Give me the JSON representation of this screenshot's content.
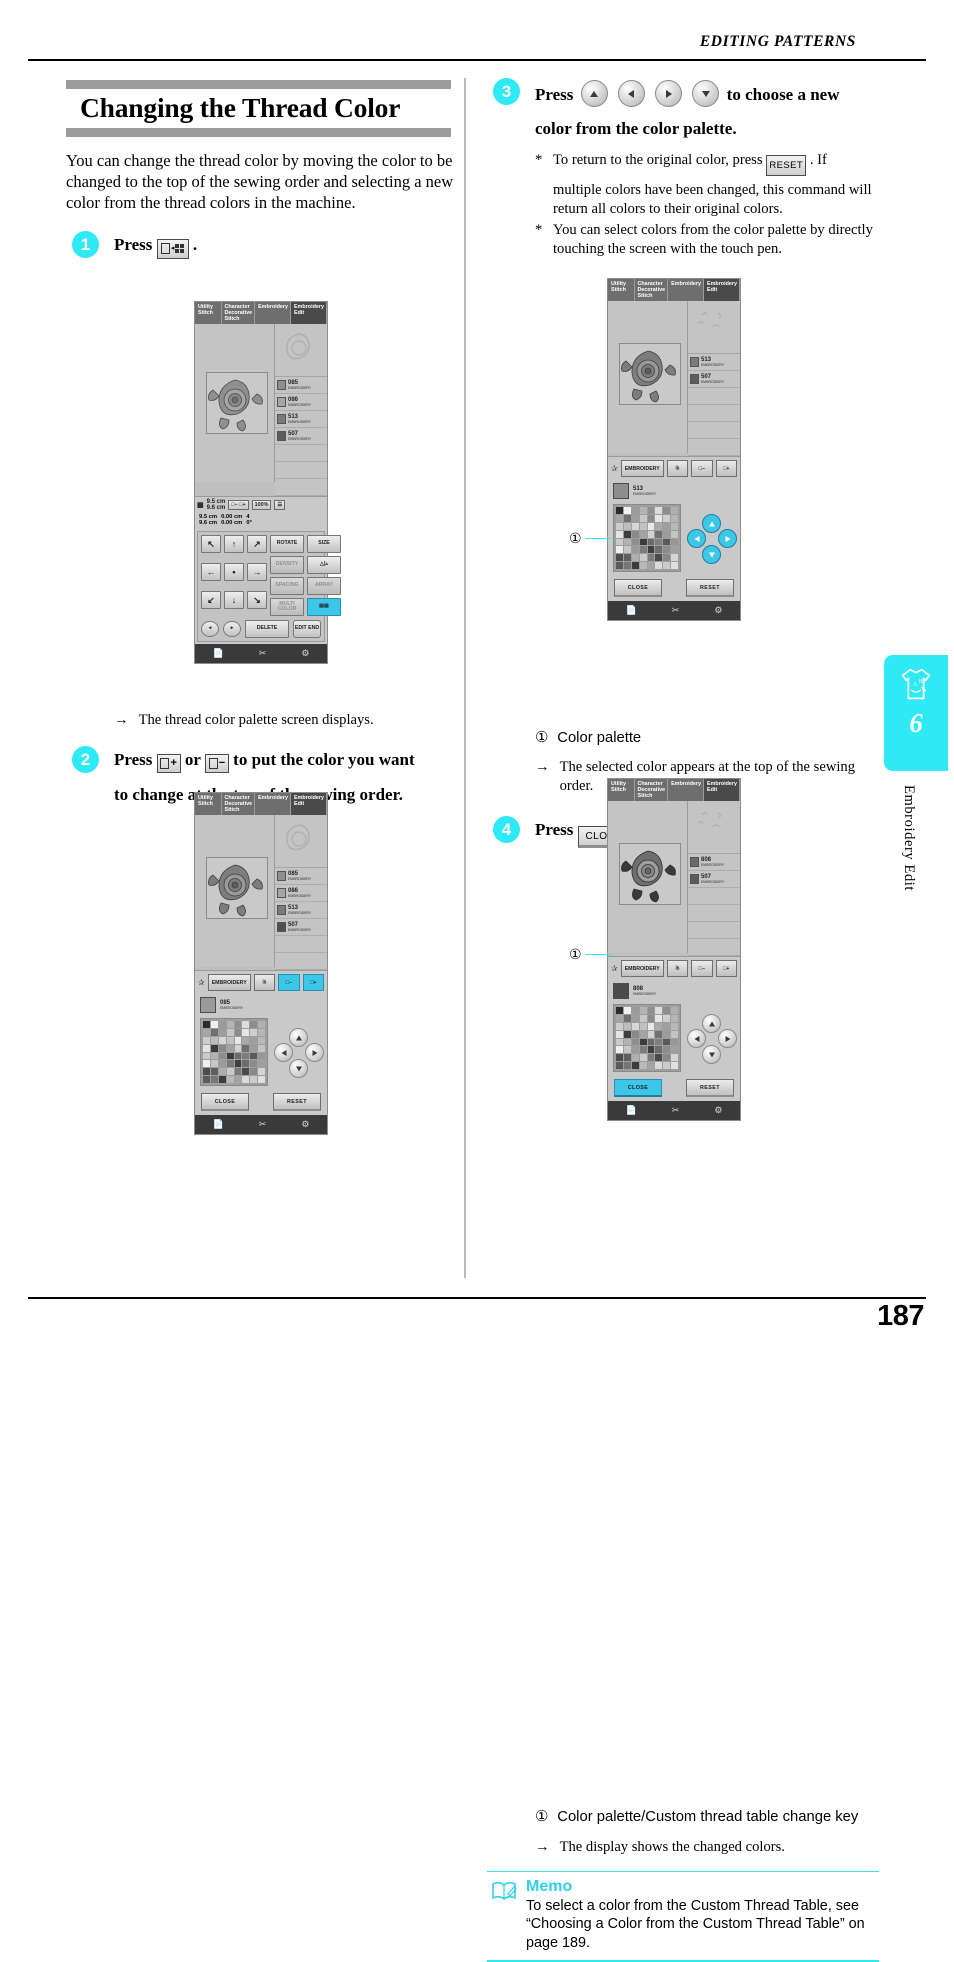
{
  "header": {
    "running_head": "EDITING PATTERNS",
    "page_number": "187"
  },
  "side_tab": {
    "chapter_number": "6",
    "chapter_label": "Embroidery Edit",
    "icon": "tshirt-icon"
  },
  "section": {
    "title": "Changing the Thread Color",
    "intro": "You can change the thread color by moving the color to be changed to the top of the sewing order and selecting a new color from the thread colors in the machine."
  },
  "steps": {
    "one": {
      "number": "1",
      "press_label": "Press",
      "key_label": "color-shuffle-key",
      "period": ".",
      "result": "The thread color palette screen displays.",
      "arrow": "→",
      "caption": ""
    },
    "two": {
      "number": "2",
      "press_label": "Press",
      "key_plus": "+",
      "key_minus": "−",
      "or_label": "or",
      "line1_tail": "to put the color you want",
      "line2": "to change at the top of the sewing order."
    },
    "three": {
      "number": "3",
      "press_label": "Press",
      "line1_tail": "to choose a new",
      "line2": "color from the color palette.",
      "notes": [
        {
          "star": "*",
          "pre": "To return to the original color, press",
          "key": "RESET",
          "post": ". If",
          "rest": "multiple colors have been changed, this command will return all colors to their original colors."
        },
        {
          "star": "*",
          "pre": "",
          "key": "",
          "post": "",
          "rest": "You can select colors from the color palette by directly touching the screen with the touch pen."
        }
      ],
      "callout": {
        "num": "①",
        "text": "Color palette"
      },
      "arrow": "→",
      "result": "The selected color appears at the top of the sewing order."
    },
    "four": {
      "number": "4",
      "press_label": "Press",
      "key_close": "CLOSE",
      "period": ".",
      "callout": {
        "num": "①",
        "text": "Color palette/Custom thread table change key"
      },
      "arrow": "→",
      "result": "The display shows the changed colors."
    }
  },
  "memo": {
    "title": "Memo",
    "icon": "memo-book-icon",
    "text": "To select a color from the Custom Thread Table, see “Choosing a Color from the Custom Thread Table” on page 189."
  },
  "machine_screens": {
    "tabs": [
      {
        "label": "Utility Stitch",
        "active": false
      },
      {
        "label": "Character Decorative Stitch",
        "active": false
      },
      {
        "label": "Embroidery",
        "active": false
      },
      {
        "label": "Embroidery Edit",
        "active": true
      }
    ],
    "screen1": {
      "colors": [
        {
          "num": "085",
          "name": "EMBROIDERY",
          "swatch": "#8e8e8e"
        },
        {
          "num": "086",
          "name": "EMBROIDERY",
          "swatch": "#a5a5a5"
        },
        {
          "num": "513",
          "name": "EMBROIDERY",
          "swatch": "#7a7a7a"
        },
        {
          "num": "507",
          "name": "EMBROIDERY",
          "swatch": "#5c5c5c"
        }
      ],
      "measure": {
        "size_w": "9.5 cm",
        "size_h": "9.6 cm",
        "zoom": "100%",
        "offset_v": "0.00 cm",
        "offset_h": "0.00 cm",
        "count": "4",
        "angle": "0°"
      },
      "pad": {
        "rotate": "ROTATE",
        "size": "SIZE",
        "density": "DENSITY",
        "mirror": "mirror-icon",
        "spacing": "SPACING",
        "array": "ARRAY",
        "multi_color": "MULTI COLOR",
        "color_shuffle": "color-shuffle-icon",
        "delete": "DELETE",
        "edit_end": "EDIT END"
      }
    },
    "screen2": {
      "colors": [
        {
          "num": "085",
          "name": "EMBROIDERY",
          "swatch": "#8e8e8e"
        },
        {
          "num": "086",
          "name": "EMBROIDERY",
          "swatch": "#a5a5a5"
        },
        {
          "num": "513",
          "name": "EMBROIDERY",
          "swatch": "#7a7a7a"
        },
        {
          "num": "507",
          "name": "EMBROIDERY",
          "swatch": "#4f4f4f"
        }
      ],
      "toolbar": {
        "mode": "EMBROIDERY",
        "minus": "−",
        "plus": "+",
        "highlight": "plus-minus"
      },
      "selected": {
        "num": "085",
        "name": "EMBROIDERY",
        "swatch": "#9a9a9a"
      },
      "close": "CLOSE",
      "reset": "RESET"
    },
    "screen3": {
      "colors": [
        {
          "num": "513",
          "name": "EMBROIDERY",
          "swatch": "#7a7a7a"
        },
        {
          "num": "507",
          "name": "EMBROIDERY",
          "swatch": "#5c5c5c"
        }
      ],
      "toolbar": {
        "mode": "EMBROIDERY",
        "minus": "−",
        "plus": "+",
        "highlight": "none"
      },
      "selected": {
        "num": "513",
        "name": "EMBROIDERY",
        "swatch": "#8d8d8d"
      },
      "close": "CLOSE",
      "reset": "RESET",
      "dpad_highlight": "all",
      "callout_num": "①"
    },
    "screen4": {
      "colors": [
        {
          "num": "808",
          "name": "EMBROIDERY",
          "swatch": "#6a6a6a"
        },
        {
          "num": "507",
          "name": "EMBROIDERY",
          "swatch": "#5c5c5c"
        }
      ],
      "toolbar": {
        "mode": "EMBROIDERY",
        "minus": "−",
        "plus": "+",
        "highlight": "none"
      },
      "selected": {
        "num": "808",
        "name": "EMBROIDERY",
        "swatch": "#4a4a4a"
      },
      "close": "CLOSE",
      "reset": "RESET",
      "close_highlight": true,
      "callout_num": "①"
    },
    "palette_rows": [
      [
        "#2b2b2b",
        "#f0f0f0",
        "#9a9a9a",
        "#b4b4b4",
        "#8f8f8f",
        "#dcdcdc",
        "#8d8d8d",
        "#b0b0b0"
      ],
      [
        "#a6a6a6",
        "#6f6f6f",
        "#9d9d9d",
        "#c8c8c8",
        "#8b8b8b",
        "#e6e6e6",
        "#cfcfcf",
        "#b6b6b6"
      ],
      [
        "#cdcdcd",
        "#bdbdbd",
        "#d6d6d6",
        "#c2c2c2",
        "#e9e9e9",
        "#a9a9a9",
        "#9f9f9f",
        "#b8b8b8"
      ],
      [
        "#e4e4e4",
        "#3d3d3d",
        "#8a8a8a",
        "#a3a3a3",
        "#d2d2d2",
        "#707070",
        "#9c9c9c",
        "#c4c4c4"
      ],
      [
        "#cacaca",
        "#b2b2b2",
        "#8e8e8e",
        "#3b3b3b",
        "#6b6b6b",
        "#7e7e7e",
        "#5a5a5a",
        "#979797"
      ],
      [
        "#efefef",
        "#c6c6c6",
        "#9b9b9b",
        "#7c7c7c",
        "#3f3f3f",
        "#6d6d6d",
        "#8c8c8c",
        "#a0a0a0"
      ],
      [
        "#4c4c4c",
        "#5f5f5f",
        "#aeaeae",
        "#c9c9c9",
        "#7b7b7b",
        "#4a4a4a",
        "#888888",
        "#d5d5d5"
      ],
      [
        "#5b5b5b",
        "#767676",
        "#3c3c3c",
        "#b9b9b9",
        "#a4a4a4",
        "#dadada",
        "#cccccc",
        "#e0e0e0"
      ]
    ],
    "bottom_icons": [
      "manual-icon",
      "needle-icon",
      "bobbin-icon"
    ]
  }
}
